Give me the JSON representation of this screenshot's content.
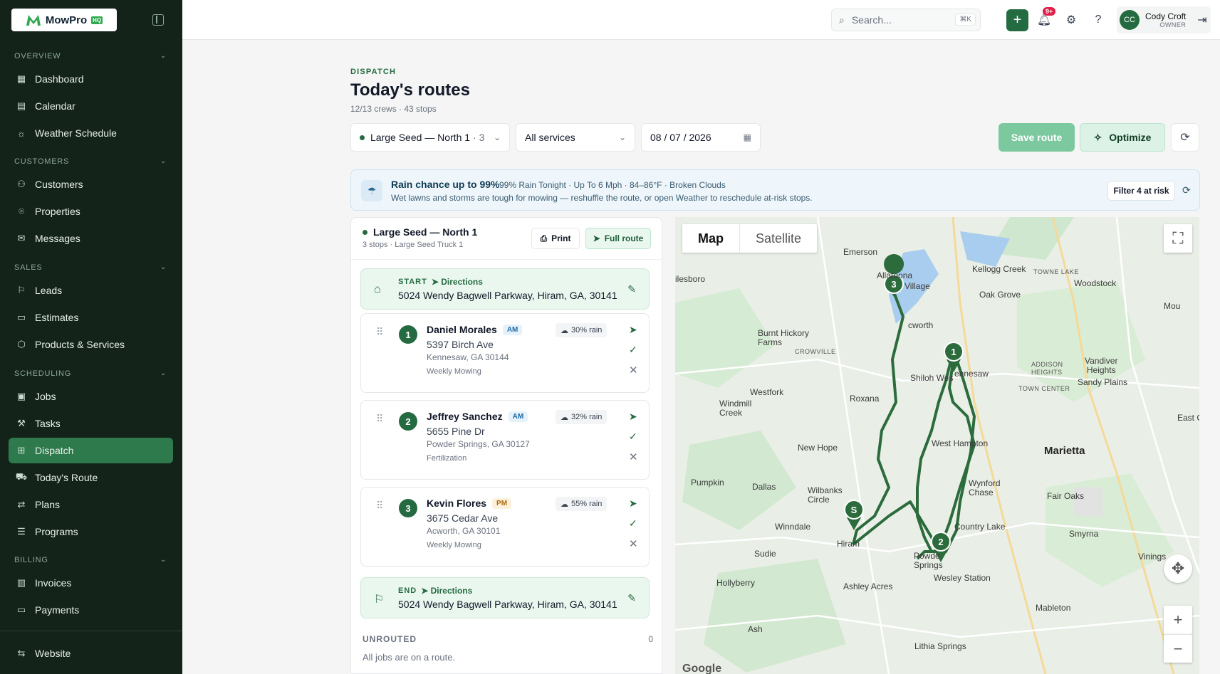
{
  "brand": {
    "name": "MowPro",
    "badge": "HQ"
  },
  "sidebar": {
    "sections": [
      {
        "label": "OVERVIEW",
        "items": [
          {
            "label": "Dashboard",
            "icon": "grid-icon"
          },
          {
            "label": "Calendar",
            "icon": "calendar-icon"
          },
          {
            "label": "Weather Schedule",
            "icon": "sun-cloud-icon"
          }
        ]
      },
      {
        "label": "CUSTOMERS",
        "items": [
          {
            "label": "Customers",
            "icon": "users-icon"
          },
          {
            "label": "Properties",
            "icon": "map-pin-icon"
          },
          {
            "label": "Messages",
            "icon": "mail-icon"
          }
        ]
      },
      {
        "label": "SALES",
        "items": [
          {
            "label": "Leads",
            "icon": "flag-icon"
          },
          {
            "label": "Estimates",
            "icon": "receipt-icon"
          },
          {
            "label": "Products & Services",
            "icon": "box-icon"
          }
        ]
      },
      {
        "label": "SCHEDULING",
        "items": [
          {
            "label": "Jobs",
            "icon": "briefcase-icon"
          },
          {
            "label": "Tasks",
            "icon": "wrench-icon"
          },
          {
            "label": "Dispatch",
            "icon": "dispatch-icon",
            "active": true
          },
          {
            "label": "Today's Route",
            "icon": "route-icon"
          },
          {
            "label": "Plans",
            "icon": "repeat-icon"
          },
          {
            "label": "Programs",
            "icon": "list-icon"
          }
        ]
      },
      {
        "label": "BILLING",
        "items": [
          {
            "label": "Invoices",
            "icon": "invoice-icon"
          },
          {
            "label": "Payments",
            "icon": "card-icon"
          }
        ]
      }
    ],
    "footer": {
      "label": "Website",
      "icon": "swap-icon"
    }
  },
  "topbar": {
    "search_placeholder": "Search...",
    "search_shortcut": "⌘K",
    "notif_count": "9+",
    "user_initials": "CC",
    "user_name": "Cody Croft",
    "user_role": "OWNER"
  },
  "page": {
    "eyebrow": "DISPATCH",
    "title": "Today's routes",
    "subtitle": "12/13 crews · 43 stops"
  },
  "filters": {
    "crew": "Large Seed — North 1",
    "crew_count": "· 3",
    "services": "All services",
    "date": "08 / 07 / 2026",
    "save_label": "Save route",
    "optimize_label": "Optimize"
  },
  "weather": {
    "title": "Rain chance up to 99%",
    "detail": "99% Rain Tonight · Up To 6 Mph · 84–86°F · Broken Clouds",
    "sub": "Wet lawns and storms are tough for mowing — reshuffle the route, or open Weather to reschedule at-risk stops.",
    "filter_label": "Filter 4 at risk"
  },
  "route": {
    "name": "Large Seed — North 1",
    "meta": "3 stops · Large Seed Truck 1",
    "print_label": "Print",
    "full_label": "Full route",
    "start": {
      "label": "START",
      "directions": "Directions",
      "address": "5024 Wendy Bagwell Parkway, Hiram, GA, 30141"
    },
    "end": {
      "label": "END",
      "directions": "Directions",
      "address": "5024 Wendy Bagwell Parkway, Hiram, GA, 30141"
    },
    "stops": [
      {
        "num": "1",
        "name": "Daniel Morales",
        "slot": "AM",
        "address": "5397 Birch Ave",
        "city": "Kennesaw, GA 30144",
        "service": "Weekly Mowing",
        "rain": "30% rain"
      },
      {
        "num": "2",
        "name": "Jeffrey Sanchez",
        "slot": "AM",
        "address": "5655 Pine Dr",
        "city": "Powder Springs, GA 30127",
        "service": "Fertilization",
        "rain": "32% rain"
      },
      {
        "num": "3",
        "name": "Kevin Flores",
        "slot": "PM",
        "address": "3675 Cedar Ave",
        "city": "Acworth, GA 30101",
        "service": "Weekly Mowing",
        "rain": "55% rain"
      }
    ],
    "unrouted_label": "UNROUTED",
    "unrouted_count": "0",
    "unrouted_text": "All jobs are on a route."
  },
  "map": {
    "tab_map": "Map",
    "tab_satellite": "Satellite",
    "places": {
      "emerson": "Emerson",
      "allatoona": "Allatoona",
      "village": "Village",
      "kellogg": "Kellogg Creek",
      "towne_lake": "TOWNE LAKE",
      "woodstock": "Woodstock",
      "oak_grove": "Oak Grove",
      "ilesboro": "ilesboro",
      "acworth": "cworth",
      "burnt_hickory": "Burnt Hickory\nFarms",
      "crowville": "CROWVILLE",
      "shiloh": "Shiloh Wes",
      "kennesaw": "ennesaw",
      "addison": "ADDISON\nHEIGHTS",
      "vandiver": "Vandiver\nHeights",
      "sandy_plains": "Sandy Plains",
      "town_center": "TOWN CENTER",
      "westfork": "Westfork",
      "roxana": "Roxana",
      "windmill": "Windmill\nCreek",
      "east_c": "East C",
      "west_hampton": "West Hampton",
      "marietta": "Marietta",
      "new_hope": "New Hope",
      "pumpkin": "Pumpkin",
      "dallas": "Dallas",
      "wilbanks": "Wilbanks\nCircle",
      "wynford": "Wynford\nChase",
      "fair_oaks": "Fair Oaks",
      "winndale": "Winndale",
      "hiram": "Hiram",
      "country_lake": "Country Lake",
      "smyrna": "Smyrna",
      "vinings": "Vinings",
      "sudie": "Sudie",
      "powder": "Powde\nSprings",
      "wesley": "Wesley Station",
      "hollyberry": "Hollyberry",
      "ashley": "Ashley Acres",
      "mableton": "Mableton",
      "ash": "Ash",
      "lithia": "Lithia Springs",
      "mou": "Mou"
    },
    "markers": {
      "m1": "1",
      "m2": "2",
      "m3": "3",
      "ms": "S"
    },
    "attribution": "Google"
  },
  "colors": {
    "accent": "#256b41",
    "sidebar": "#13231a",
    "route": "#2c6b3c"
  }
}
